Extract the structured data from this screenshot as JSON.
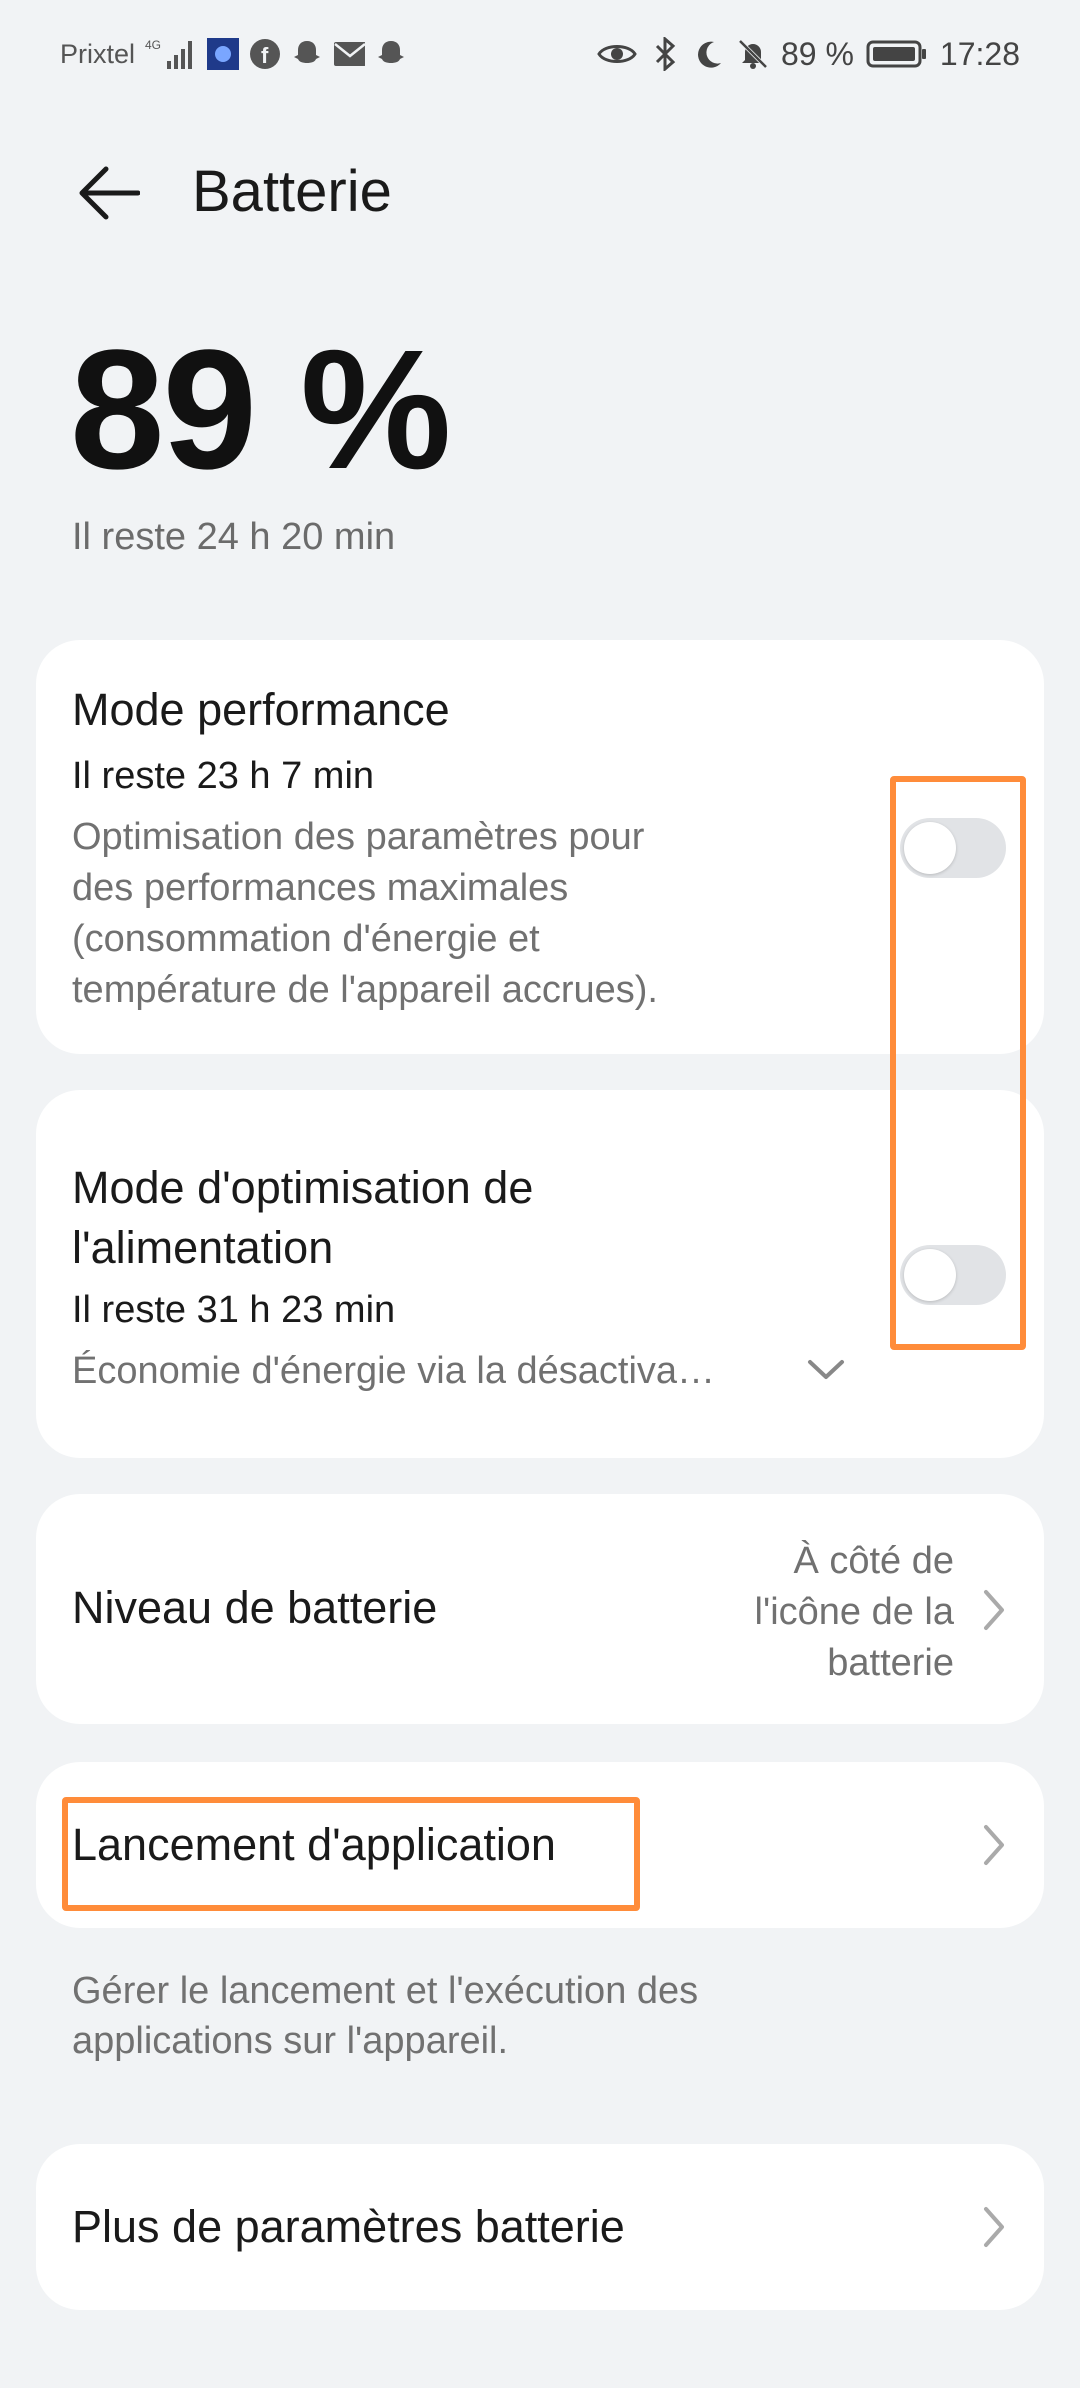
{
  "status_bar": {
    "carrier": "Prixtel",
    "network": "4G",
    "battery_percent": "89 %",
    "time": "17:28"
  },
  "header": {
    "title": "Batterie"
  },
  "battery": {
    "percent": "89 %",
    "remaining": "Il reste 24 h 20 min"
  },
  "performance_mode": {
    "title": "Mode performance",
    "remaining": "Il reste 23 h 7 min",
    "description_lines": [
      "Optimisation des paramètres pour",
      "des performances maximales",
      "(consommation d'énergie et",
      "température de l'appareil accrues)."
    ],
    "enabled": false
  },
  "power_optimization_mode": {
    "title_lines": [
      "Mode d'optimisation de",
      "l'alimentation"
    ],
    "remaining": "Il reste 31 h 23 min",
    "description": "Économie d'énergie via la désactiva…",
    "enabled": false
  },
  "battery_level": {
    "label": "Niveau de batterie",
    "value_lines": [
      "À côté de",
      "l'icône de la",
      "batterie"
    ]
  },
  "app_launch": {
    "label": "Lancement d'application",
    "note_lines": [
      "Gérer le lancement et l'exécution des",
      "applications sur l'appareil."
    ]
  },
  "more_settings": {
    "label": "Plus de paramètres batterie"
  },
  "colors": {
    "background": "#f1f3f5",
    "card": "#ffffff",
    "highlight": "#ff8c3a",
    "toggle_off": "#e1e3e6"
  }
}
